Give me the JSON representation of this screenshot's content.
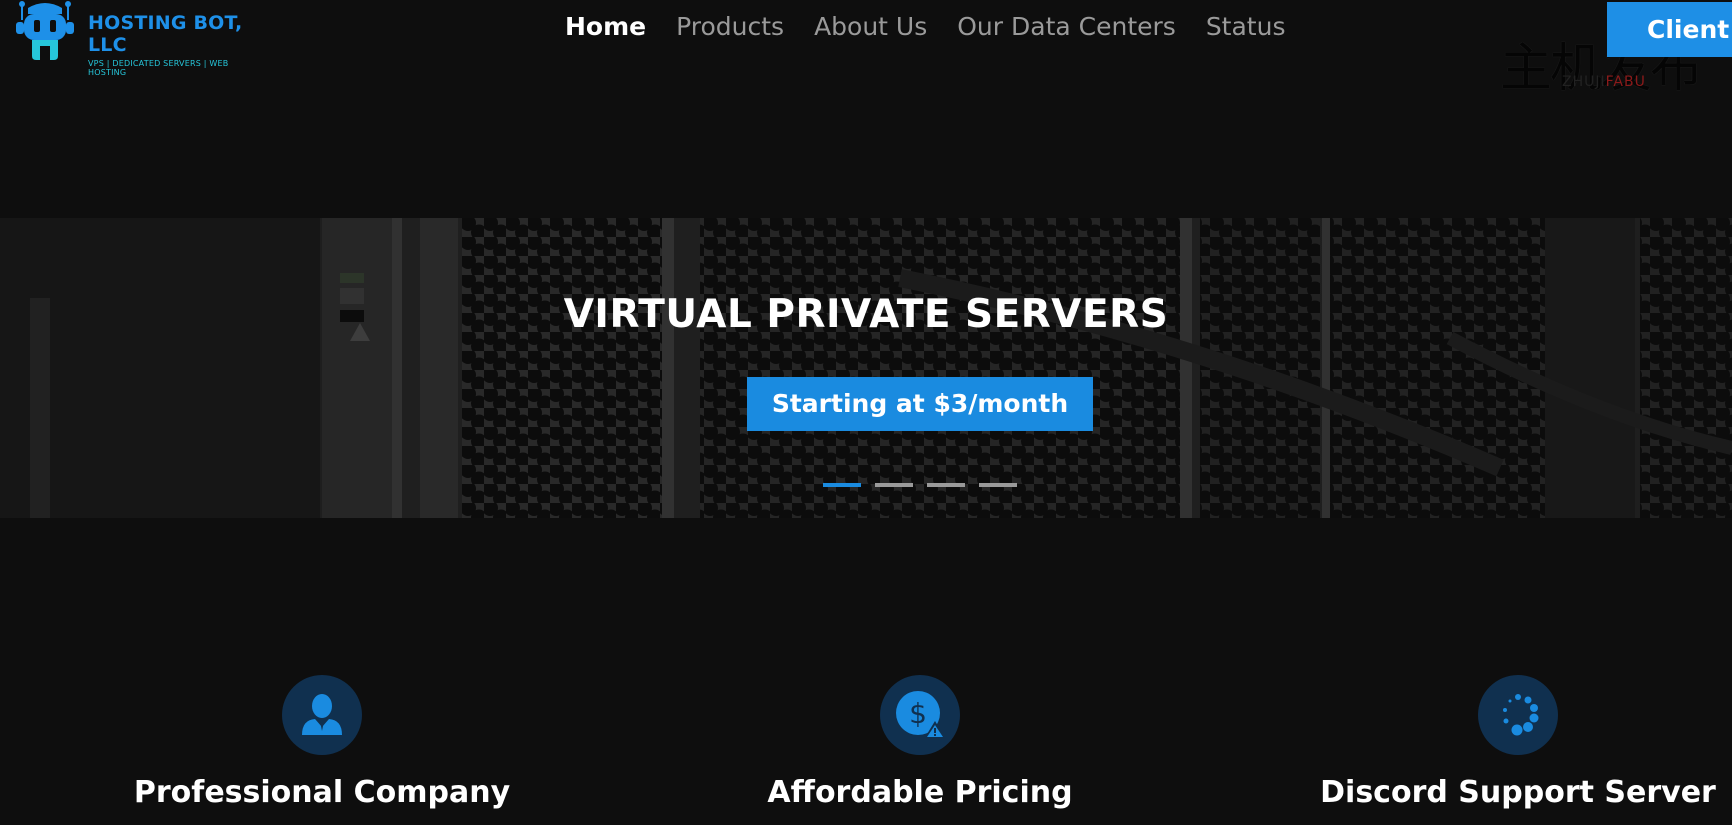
{
  "brand": {
    "name": "HOSTING BOT, LLC",
    "tagline": "VPS | DEDICATED SERVERS | WEB HOSTING"
  },
  "nav": {
    "items": [
      {
        "label": "Home",
        "active": true
      },
      {
        "label": "Products",
        "active": false
      },
      {
        "label": "About Us",
        "active": false
      },
      {
        "label": "Our Data Centers",
        "active": false
      },
      {
        "label": "Status",
        "active": false
      }
    ],
    "client_button": "Client A"
  },
  "watermark": {
    "chinese": "主机发布",
    "latin_a": "ZHUJI",
    "latin_b": "FABU"
  },
  "hero": {
    "title": "VIRTUAL PRIVATE SERVERS",
    "cta": "Starting at $3/month",
    "slides": 4,
    "active_slide": 1
  },
  "features": [
    {
      "label": "Professional Company",
      "icon": "person-icon"
    },
    {
      "label": "Affordable Pricing",
      "icon": "dollar-warning-icon"
    },
    {
      "label": "Discord Support Server",
      "icon": "spinner-icon"
    }
  ],
  "colors": {
    "accent": "#1a8be0",
    "background": "#0e0e0e",
    "icon_circle": "#10304f"
  }
}
